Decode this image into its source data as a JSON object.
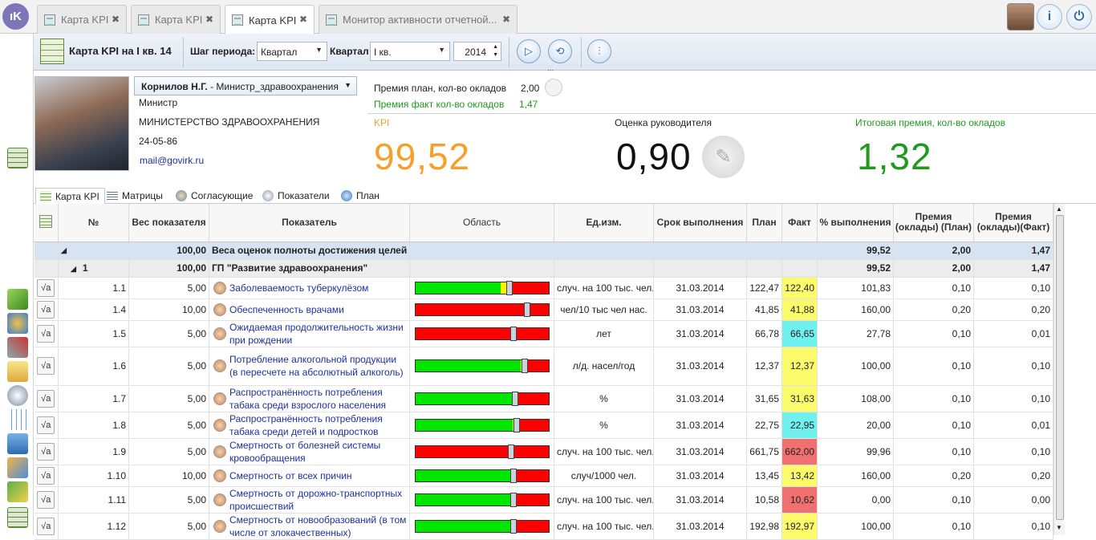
{
  "app": {
    "logo_text": "ıK"
  },
  "tabs": [
    {
      "label": "Карта KPI",
      "active": false
    },
    {
      "label": "Карта KPI",
      "active": false
    },
    {
      "label": "Карта KPI",
      "active": true
    },
    {
      "label": "Монитор активности отчетной...",
      "active": false
    }
  ],
  "toolbar": {
    "title": "Карта KPI на I кв. 14",
    "step_label": "Шаг периода:",
    "step_value": "Квартал",
    "quarter_label": "Квартал",
    "quarter_value": "I кв.",
    "year_value": "2014",
    "more_label": "..."
  },
  "person": {
    "name": "Корнилов Н.Г.",
    "role_suffix": " - Министр_здравоохранения",
    "position": "Министр",
    "org": "МИНИСТЕРСТВО ЗДРАВООХРАНЕНИЯ",
    "phone": "24-05-86",
    "email": "mail@govirk.ru"
  },
  "bonus": {
    "plan_label": "Премия план, кол-во окладов",
    "plan_value": "2,00",
    "fact_label": "Премия факт кол-во окладов",
    "fact_value": "1,47"
  },
  "kpi": {
    "kpi_label": "KPI",
    "kpi_value": "99,52",
    "mgr_label": "Оценка руководителя",
    "mgr_value": "0,90",
    "total_label": "Итоговая премия, кол-во окладов",
    "total_value": "1,32"
  },
  "colors": {
    "kpi": "#f5a02a",
    "total": "#1e9a1e",
    "link": "#1f2f9f",
    "fact_green": "#1e9a1e"
  },
  "panel_tabs": [
    "Карта KPI",
    "Матрицы",
    "Согласующие",
    "Показатели",
    "План"
  ],
  "columns": [
    "№",
    "Вес показателя",
    "Показатель",
    "Область",
    "Ед.изм.",
    "Срок выполнения",
    "План",
    "Факт",
    "% выполнения",
    "Премия (оклады) (План)",
    "Премия (оклады)(Факт)"
  ],
  "group0": {
    "weight": "100,00",
    "name": "Веса оценок полноты достижения целей",
    "pct": "99,52",
    "plan": "2,00",
    "fact": "1,47"
  },
  "group1": {
    "num": "1",
    "weight": "100,00",
    "name": "ГП \"Развитие здравоохранения\"",
    "pct": "99,52",
    "plan": "2,00",
    "fact": "1,47"
  },
  "rows": [
    {
      "num": "1.1",
      "weight": "5,00",
      "name": "Заболеваемость туберкулёзом",
      "unit": "случ. на 100 тыс. чел.",
      "due": "31.03.2014",
      "plan": "122,47",
      "fact": "122,40",
      "fact_color": "yellow",
      "pct": "101,83",
      "bplan": "0,10",
      "bfact": "0,10",
      "bar": {
        "green": 0.64,
        "yellow": 0.06,
        "marker": 0.71
      }
    },
    {
      "num": "1.4",
      "weight": "10,00",
      "name": "Обеспеченность врачами",
      "unit": "чел/10 тыс чел нас.",
      "due": "31.03.2014",
      "plan": "41,85",
      "fact": "41,88",
      "fact_color": "yellow",
      "pct": "160,00",
      "bplan": "0,20",
      "bfact": "0,20",
      "bar": {
        "green": 0.0,
        "yellow": 0.0,
        "marker": 0.84
      }
    },
    {
      "num": "1.5",
      "weight": "5,00",
      "name": "Ожидаемая продолжительность жизни при рождении",
      "unit": "лет",
      "due": "31.03.2014",
      "plan": "66,78",
      "fact": "66,65",
      "fact_color": "cyan",
      "pct": "27,78",
      "bplan": "0,10",
      "bfact": "0,01",
      "bar": {
        "green": 0.0,
        "yellow": 0.0,
        "marker": 0.74
      }
    },
    {
      "num": "1.6",
      "weight": "5,00",
      "name": "Потребление алкогольной продукции (в пересчете на абсолютный алкоголь)",
      "unit": "л/д. насел/год",
      "due": "31.03.2014",
      "plan": "12,37",
      "fact": "12,37",
      "fact_color": "yellow",
      "pct": "100,00",
      "bplan": "0,10",
      "bfact": "0,10",
      "bar": {
        "green": 0.79,
        "yellow": 0.02,
        "marker": 0.82
      }
    },
    {
      "num": "1.7",
      "weight": "5,00",
      "name": "Распространённость потребления табака среди взрослого населения",
      "unit": "%",
      "due": "31.03.2014",
      "plan": "31,65",
      "fact": "31,63",
      "fact_color": "yellow",
      "pct": "108,00",
      "bplan": "0,10",
      "bfact": "0,10",
      "bar": {
        "green": 0.73,
        "yellow": 0.02,
        "marker": 0.75
      }
    },
    {
      "num": "1.8",
      "weight": "5,00",
      "name": "Распространённость потребления табака среди детей и подростков",
      "unit": "%",
      "due": "31.03.2014",
      "plan": "22,75",
      "fact": "22,95",
      "fact_color": "cyan",
      "pct": "20,00",
      "bplan": "0,10",
      "bfact": "0,01",
      "bar": {
        "green": 0.73,
        "yellow": 0.04,
        "marker": 0.76
      }
    },
    {
      "num": "1.9",
      "weight": "5,00",
      "name": "Смертность от болезней системы кровообращения",
      "unit": "случ. на 100 тыс. чел.",
      "due": "31.03.2014",
      "plan": "661,75",
      "fact": "662,00",
      "fact_color": "red",
      "pct": "99,96",
      "bplan": "0,10",
      "bfact": "0,10",
      "bar": {
        "green": 0.0,
        "yellow": 0.0,
        "marker": 0.72
      }
    },
    {
      "num": "1.10",
      "weight": "10,00",
      "name": "Смертность от всех причин",
      "unit": "случ/1000 чел.",
      "due": "31.03.2014",
      "plan": "13,45",
      "fact": "13,42",
      "fact_color": "yellow",
      "pct": "160,00",
      "bplan": "0,20",
      "bfact": "0,20",
      "bar": {
        "green": 0.73,
        "yellow": 0.02,
        "marker": 0.74
      }
    },
    {
      "num": "1.11",
      "weight": "5,00",
      "name": "Смертность от дорожно-транспортных происшествий",
      "unit": "случ. на 100 тыс. чел.",
      "due": "31.03.2014",
      "plan": "10,58",
      "fact": "10,62",
      "fact_color": "red",
      "pct": "0,00",
      "bplan": "0,10",
      "bfact": "0,00",
      "bar": {
        "green": 0.73,
        "yellow": 0.02,
        "marker": 0.74
      }
    },
    {
      "num": "1.12",
      "weight": "5,00",
      "name": "Смертность от новообразований (в том числе от злокачественных)",
      "unit": "случ. на 100 тыс. чел.",
      "due": "31.03.2014",
      "plan": "192,98",
      "fact": "192,97",
      "fact_color": "yellow",
      "pct": "100,00",
      "bplan": "0,10",
      "bfact": "0,10",
      "bar": {
        "green": 0.73,
        "yellow": 0.02,
        "marker": 0.74
      }
    }
  ]
}
